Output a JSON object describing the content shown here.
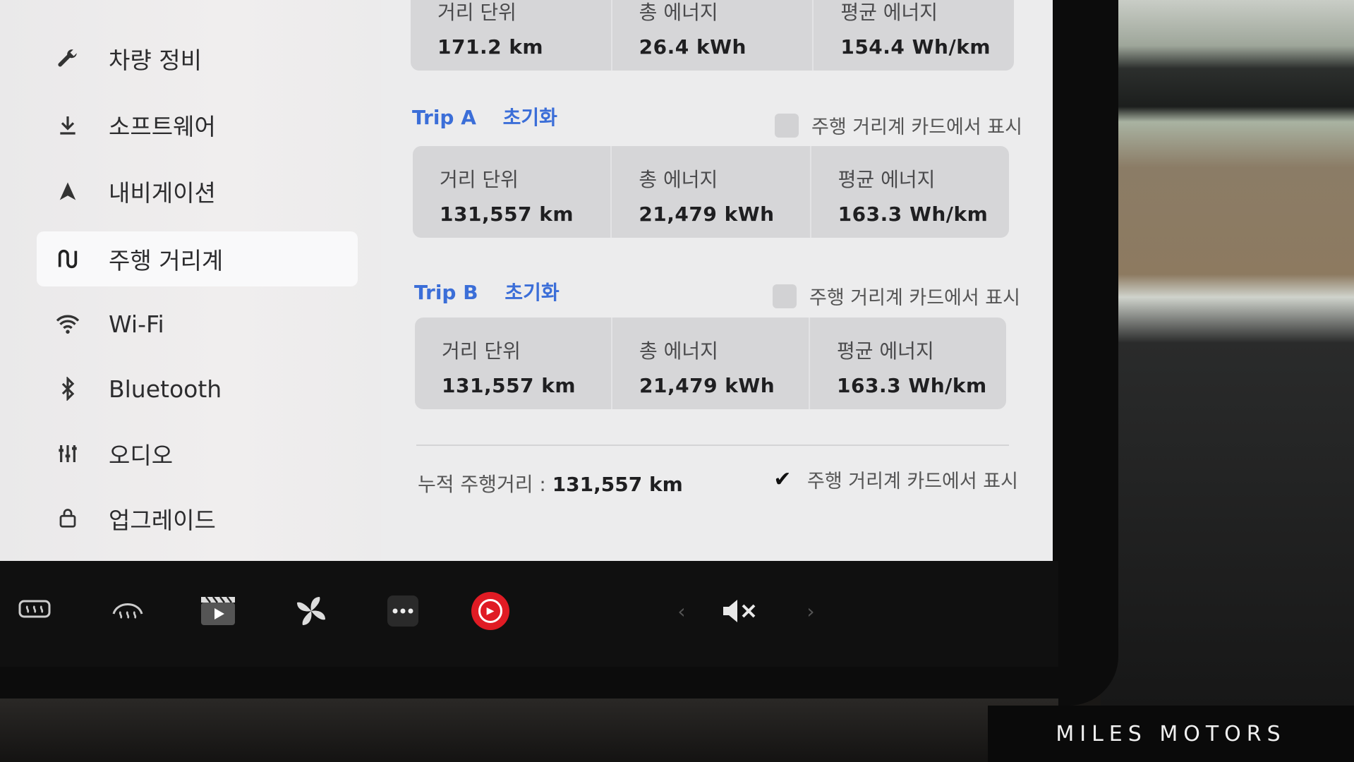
{
  "sidebar": {
    "items": [
      {
        "label": "차량 정비",
        "icon": "wrench-icon"
      },
      {
        "label": "소프트웨어",
        "icon": "download-icon"
      },
      {
        "label": "내비게이션",
        "icon": "navigation-icon"
      },
      {
        "label": "주행 거리계",
        "icon": "trip-icon",
        "active": true
      },
      {
        "label": "Wi-Fi",
        "icon": "wifi-icon"
      },
      {
        "label": "Bluetooth",
        "icon": "bluetooth-icon"
      },
      {
        "label": "오디오",
        "icon": "equalizer-icon"
      },
      {
        "label": "업그레이드",
        "icon": "shopping-bag-icon"
      }
    ]
  },
  "since_last_charge": {
    "distance_label": "거리 단위",
    "distance": "171.2 km",
    "energy_label": "총 에너지",
    "energy": "26.4 kWh",
    "avg_label": "평균 에너지",
    "avg": "154.4 Wh/km"
  },
  "trip_a": {
    "title": "Trip A",
    "reset": "초기화",
    "show_label": "주행 거리계 카드에서 표시",
    "distance_label": "거리 단위",
    "distance": "131,557 km",
    "energy_label": "총 에너지",
    "energy": "21,479 kWh",
    "avg_label": "평균 에너지",
    "avg": "163.3 Wh/km"
  },
  "trip_b": {
    "title": "Trip B",
    "reset": "초기화",
    "show_label": "주행 거리계 카드에서 표시",
    "distance_label": "거리 단위",
    "distance": "131,557 km",
    "energy_label": "총 에너지",
    "energy": "21,479 kWh",
    "avg_label": "평균 에너지",
    "avg": "163.3 Wh/km"
  },
  "odometer": {
    "label": "누적 주행거리 :",
    "value": "131,557 km",
    "show_label": "주행 거리계 카드에서 표시",
    "checkmark": "✔"
  },
  "taskbar": {
    "volume_icon": "mute-icon",
    "volume_glyph": "🔇"
  },
  "watermark": "MILES MOTORS",
  "colors": {
    "accent": "#3b6ed8",
    "record": "#e01b24"
  }
}
